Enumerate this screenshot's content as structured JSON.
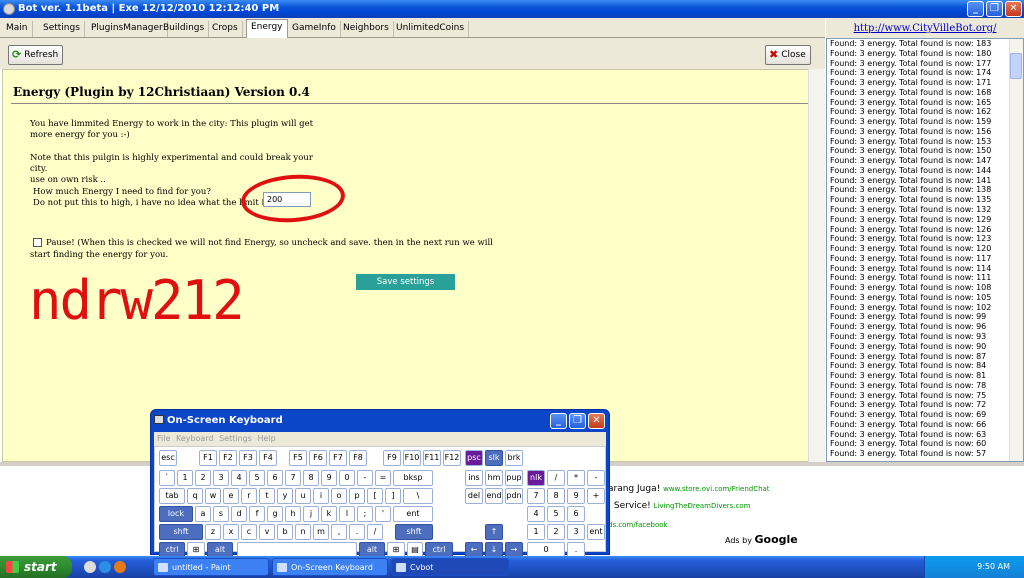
{
  "window": {
    "title": "Bot ver. 1.1beta | Exe 12/12/2010 12:12:40 PM",
    "buttons": [
      "_",
      "❐",
      "✕"
    ]
  },
  "tabs": [
    "Main",
    "Settings",
    "PluginsManager",
    "Buildings",
    "Crops",
    "Energy",
    "GameInfo",
    "Neighbors",
    "UnlimitedCoins"
  ],
  "active_tab": "Energy",
  "side_url": "http://www.CityVilleBot.org/",
  "toolbar": {
    "refresh": "Refresh",
    "close": "Close"
  },
  "plugin": {
    "heading": "Energy (Plugin by 12Christiaan) Version 0.4",
    "intro_1": "You have limmited Energy to work in the city: This plugin will get",
    "intro_2": "more energy for you :-)",
    "note_1": "Note that this pulgin is highly experimental and could break your",
    "note_2": "city.",
    "note_3": "use on own risk ..",
    "question": "How much Energy I need to find for you?",
    "warning": "Do not put this to high, i have no idea what the limit is.",
    "energy_value": "200",
    "pause_1": "Pause! (When this is checked we will not find Energy, so uncheck and save. then in the next run we will",
    "pause_2": "start finding the energy for you.",
    "pause_checked": false,
    "save_label": "Save settings",
    "watermark": "ndrw212"
  },
  "log": {
    "prefix": "Found: 3 energy. Total found is now:",
    "totals": [
      183,
      180,
      177,
      174,
      171,
      168,
      165,
      162,
      159,
      156,
      153,
      150,
      147,
      144,
      141,
      138,
      135,
      132,
      129,
      126,
      123,
      120,
      117,
      114,
      111,
      108,
      105,
      102,
      99,
      96,
      93,
      90,
      87,
      84,
      81,
      78,
      75,
      72,
      69,
      66,
      63,
      60,
      57
    ]
  },
  "ads": {
    "line1_text": "arang Juga!",
    "line1_url": "www.store.ovi.com/FriendChat",
    "line2_text": ": Service!",
    "line2_url": "LivingTheDreamDivers.com",
    "line3_url": "ds.com/facebook",
    "ads_by": "Ads by",
    "google": "Google"
  },
  "osk": {
    "title": "On-Screen Keyboard",
    "menu": [
      "File",
      "Keyboard",
      "Settings",
      "Help"
    ]
  },
  "taskbar": {
    "start": "start",
    "tasks": [
      "untitled - Paint",
      "On-Screen Keyboard",
      "Cvbot"
    ],
    "clock": "9:50 AM"
  },
  "colors": {
    "accent": "#0a55d8",
    "panel": "#ffffc8",
    "save_button": "#2aa198",
    "annotation_red": "#e01010"
  }
}
